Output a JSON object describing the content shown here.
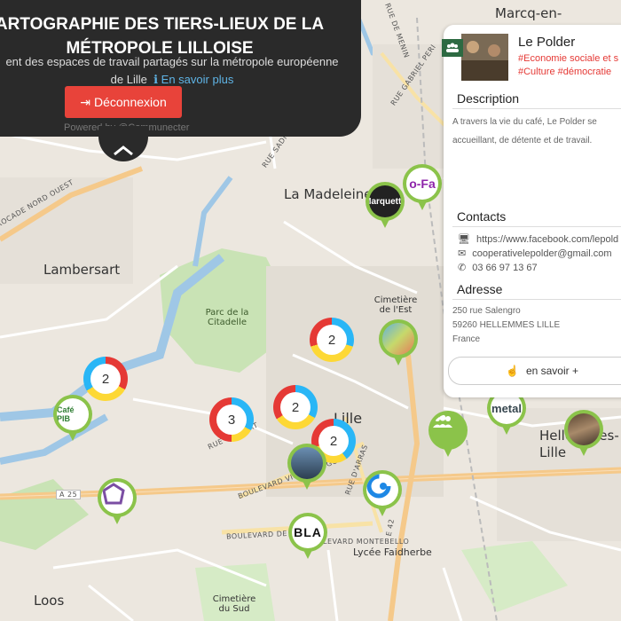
{
  "header": {
    "title": "ARTOGRAPHIE DES TIERS-LIEUX DE LA MÉTROPOLE LILLOISE",
    "subtitle_part1": "ent des espaces de travail partagés sur la métropole européenne",
    "subtitle_part2": "de Lille",
    "more_link": "En savoir plus",
    "logout_button": "Déconnexion",
    "powered_by": "Powered by @Communecter"
  },
  "map": {
    "places": {
      "marcq": "Marcq-en-",
      "la_madeleine": "La Madeleine",
      "lambersart": "Lambersart",
      "citadelle": "Parc de la Citadelle",
      "lille": "Lille",
      "cimetiere_est": "Cimetière de l'Est",
      "hellemmes": "Hellemmes-Lille",
      "loos": "Loos",
      "cimetiere_sud": "Cimetière du Sud",
      "lycee": "Lycée Faidherbe"
    },
    "streets": {
      "menin": "RUE DE MENIN",
      "gabriel_peri": "RUE GABRIEL PERI",
      "sadi_carnot": "RUE SADI CARNOT",
      "rocade": "ROCADE NORD OUEST",
      "a25": "A 25",
      "bd_victor_hugo": "BOULEVARD VICTOR HUGO",
      "bd_paris": "BOULEVARD DE PARIS",
      "bd_montebello": "BOULEVARD MONTEBELLO",
      "rue_arras": "RUE D'ARRAS",
      "rue_colbert": "RUE COLBERT",
      "e42": "E 42"
    },
    "clusters": [
      {
        "id": "c1",
        "count": "2"
      },
      {
        "id": "c2",
        "count": "2"
      },
      {
        "id": "c3",
        "count": "3"
      },
      {
        "id": "c4",
        "count": "2"
      },
      {
        "id": "c5",
        "count": "2"
      }
    ],
    "marker_labels": {
      "cafe": "Café PIB",
      "metal": "metal",
      "ofa": "o-Fa",
      "bla": "BLA",
      "marquette": "Marquette"
    }
  },
  "panel": {
    "title": "Le Polder",
    "tag1": "#Economie sociale et s",
    "tag2": "#Culture #démocratie",
    "description_heading": "Description",
    "description_line1": "A travers la vie du café, Le Polder se",
    "description_line2": "accueillant, de détente et de travail.",
    "contacts_heading": "Contacts",
    "website": "https://www.facebook.com/lepold",
    "email": "cooperativelepolder@gmail.com",
    "phone": "03 66 97 13 67",
    "address_heading": "Adresse",
    "address_line1": "250 rue Salengro",
    "address_line2": "59260 HELLEMMES LILLE",
    "address_line3": "France",
    "more_button": "en savoir +"
  },
  "colors": {
    "marker_green": "#8bc34a",
    "header_bg": "#2a2a2a",
    "logout_red": "#e8433a",
    "tag_red": "#e53935",
    "link_blue": "#5fb4e6"
  }
}
